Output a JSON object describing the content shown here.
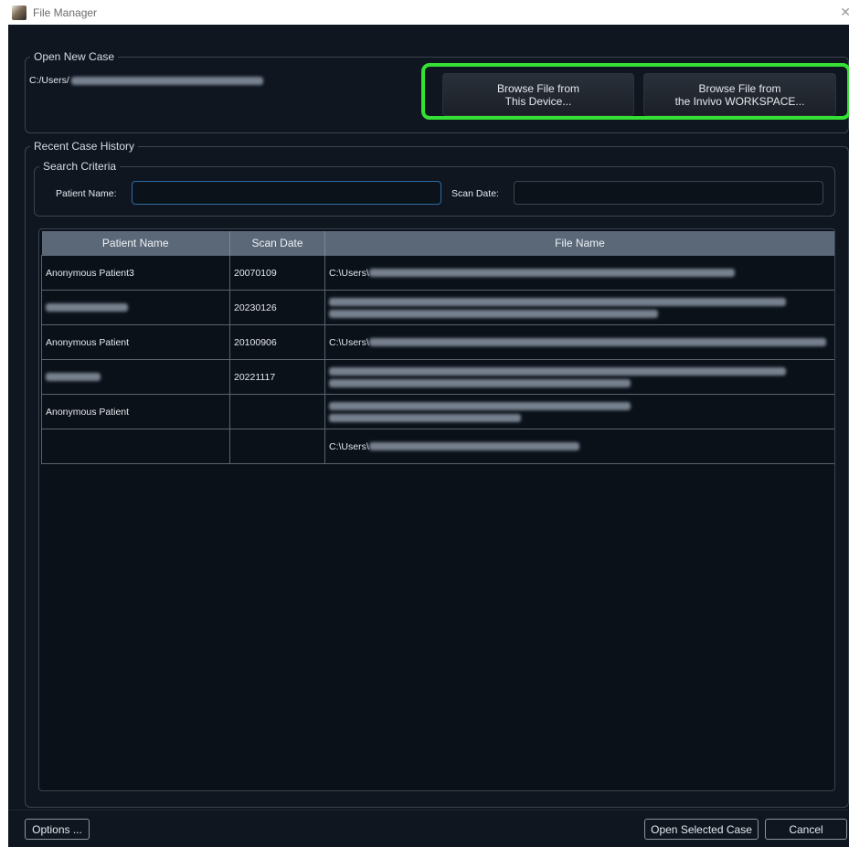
{
  "window": {
    "title": "File Manager",
    "close_glyph": "✕"
  },
  "open_new_case": {
    "group_title": "Open New Case",
    "path_prefix": "C:/Users/",
    "browse_device_line1": "Browse File from",
    "browse_device_line2": "This Device...",
    "browse_workspace_line1": "Browse File from",
    "browse_workspace_line2": "the Invivo WORKSPACE...",
    "highlight_color": "#33e033"
  },
  "recent": {
    "group_title": "Recent Case History",
    "search_title": "Search Criteria",
    "patient_name_label": "Patient Name:",
    "patient_name_value": "",
    "scan_date_label": "Scan Date:",
    "scan_date_value": ""
  },
  "table": {
    "columns": [
      "Patient Name",
      "Scan Date",
      "File Name"
    ],
    "rows": [
      {
        "patient": "Anonymous Patient3",
        "date": "20070109",
        "file_prefix": "C:\\Users\\"
      },
      {
        "patient": "",
        "date": "20230126",
        "file_prefix": ""
      },
      {
        "patient": "Anonymous Patient",
        "date": "20100906",
        "file_prefix": "C:\\Users\\"
      },
      {
        "patient": "",
        "date": "20221117",
        "file_prefix": ""
      },
      {
        "patient": "Anonymous Patient",
        "date": "",
        "file_prefix": ""
      },
      {
        "patient": "",
        "date": "",
        "file_prefix": "C:\\Users\\"
      }
    ]
  },
  "footer": {
    "options_label": "Options ...",
    "open_selected_label": "Open Selected Case",
    "cancel_label": "Cancel"
  },
  "colors": {
    "window_bg": "#0f1620",
    "header_bg": "#5b6878",
    "focus_border": "#2d6aa3"
  }
}
